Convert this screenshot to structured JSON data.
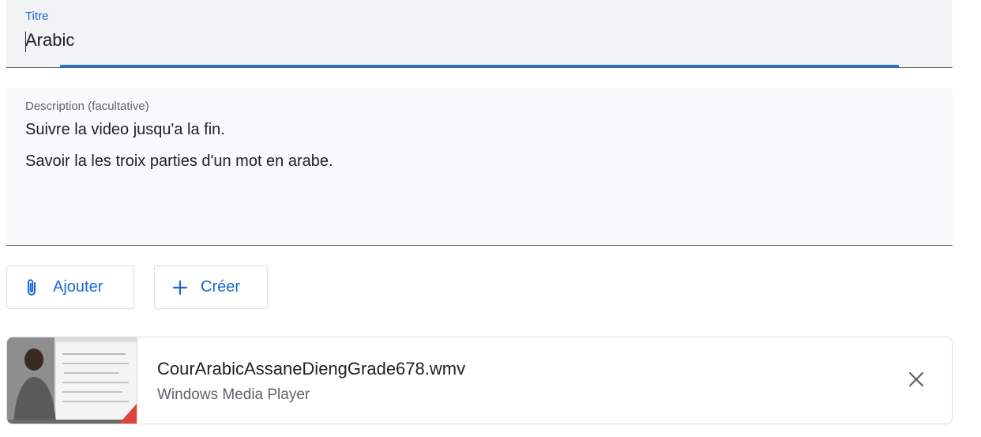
{
  "form": {
    "title": {
      "label": "Titre",
      "value": "Arabic"
    },
    "description": {
      "label": "Description (facultative)",
      "lines": [
        "Suivre la video jusqu'a la fin.",
        "Savoir la les troix parties d'un mot en arabe."
      ]
    }
  },
  "actions": {
    "add_label": "Ajouter",
    "create_label": "Créer",
    "add_icon": "paperclip-icon",
    "create_icon": "plus-icon"
  },
  "attachment": {
    "file_name": "CourArabicAssaneDiengGrade678.wmv",
    "app_name": "Windows Media Player",
    "remove_icon": "close-icon"
  },
  "colors": {
    "accent": "#1a73e8",
    "link": "#1967d2",
    "field_bg": "#f1f3f4",
    "badge": "#db4437"
  }
}
